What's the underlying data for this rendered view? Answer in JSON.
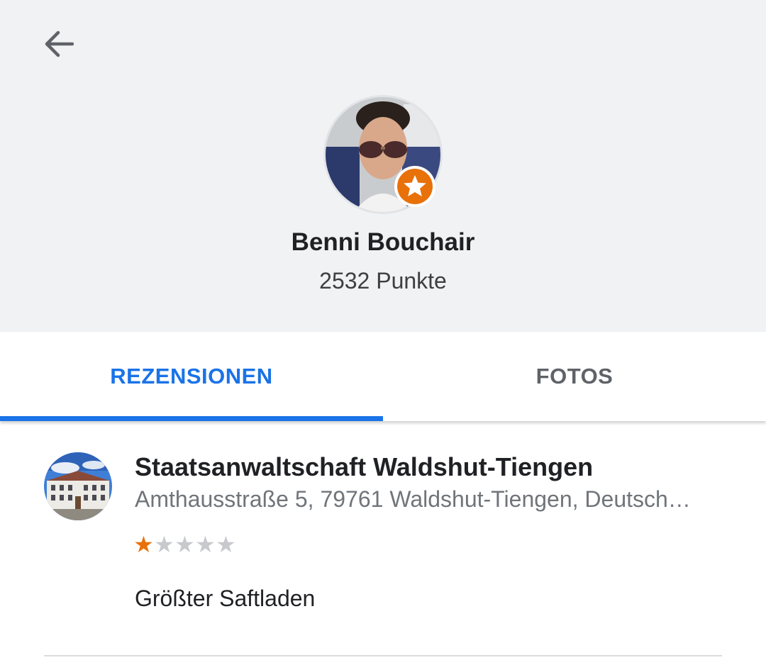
{
  "header": {
    "back_icon": "arrow-left-icon",
    "user": {
      "name": "Benni Bouchair",
      "points": "2532 Punkte",
      "badge_icon": "star-badge-icon"
    }
  },
  "tabs": [
    {
      "label": "REZENSIONEN",
      "active": true
    },
    {
      "label": "FOTOS",
      "active": false
    }
  ],
  "reviews": [
    {
      "place_name": "Staatsanwaltschaft Waldshut-Tiengen",
      "address": "Amthausstraße 5, 79761 Waldshut-Tiengen, Deutschland",
      "rating": 1,
      "max_rating": 5,
      "text": "Größter Saftladen"
    }
  ],
  "colors": {
    "accent": "#1a73e8",
    "star": "#e8710a",
    "header_bg": "#f1f2f4"
  }
}
